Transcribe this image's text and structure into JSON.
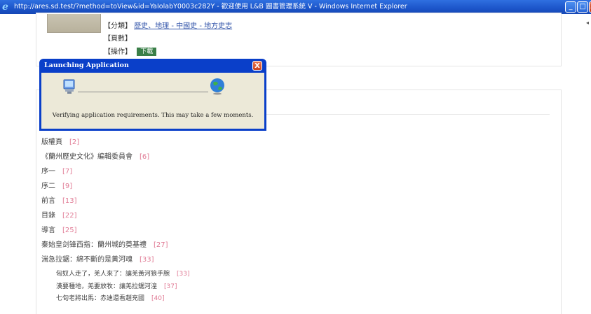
{
  "window": {
    "title": "http://ares.sd.test/?method=toView&id=YaIolabY0003c282Y - 歡迎使用 L&B 圖書管理系統 V - Windows Internet Explorer",
    "minimize_glyph": "_",
    "maximize_glyph": "□",
    "close_glyph": "X",
    "icons": {
      "browser": "ie-icon"
    }
  },
  "book": {
    "category_label": "【分類】",
    "category_links": [
      "歷史、地理 - 中國史 - 地方史志"
    ],
    "pages_label": "【頁數】",
    "pages_value": "",
    "action_label": "【操作】",
    "download_label": "下載"
  },
  "dialog": {
    "title": "Launching Application",
    "close_glyph": "X",
    "message": "Verifying application requirements. This may take a few moments.",
    "icons": {
      "computer": "computer-icon",
      "globe": "globe-icon"
    }
  },
  "toc": [
    {
      "title": "版權頁",
      "page": "[2]"
    },
    {
      "title": "《蘭州歷史文化》編輯委員會",
      "page": "[6]"
    },
    {
      "title": "序一",
      "page": "[7]"
    },
    {
      "title": "序二",
      "page": "[9]"
    },
    {
      "title": "前言",
      "page": "[13]"
    },
    {
      "title": "目錄",
      "page": "[22]"
    },
    {
      "title": "導言",
      "page": "[25]"
    },
    {
      "title": "秦始皇剑锋西指：蘭州城的奠基禮",
      "page": "[27]"
    },
    {
      "title": "湍急拉鋸：綿不斷的是黃河魂",
      "page": "[33]"
    }
  ],
  "toc_sub": [
    {
      "title": "匈奴人走了，羌人來了：讓羌黃河狼手腕",
      "page": "[33]"
    },
    {
      "title": "漢要種地，羌要放牧：讓羌拉鋸河湟",
      "page": "[37]"
    },
    {
      "title": "七旬老將出馬：赤迪還看趙充國",
      "page": "[40]"
    }
  ],
  "colors": {
    "titlebar": "#1c55c9",
    "dialog_frame": "#0a3fc9",
    "page_ref": "#e07a94",
    "download_button": "#3a7f48"
  }
}
